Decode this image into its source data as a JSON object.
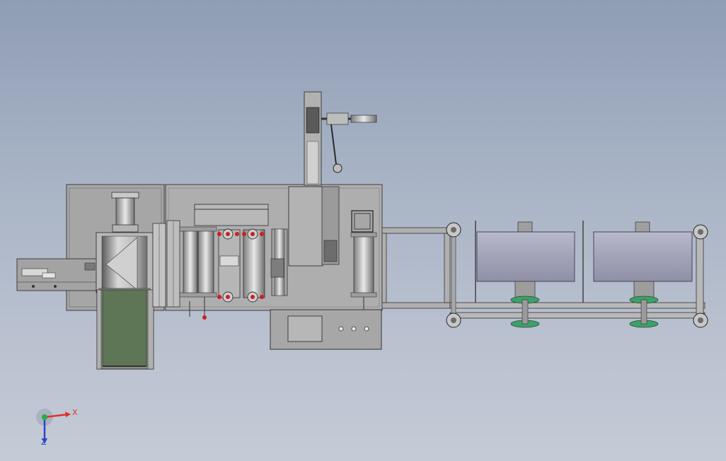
{
  "axis": {
    "x_label": "X",
    "z_label": "Z"
  },
  "colors": {
    "background_top": "#8f9db5",
    "background_bottom": "#c5cbd6",
    "machine_frame": "#a8a8a8",
    "machine_dark": "#5c5c5c",
    "roll_body": "#a9a9bd",
    "conveyor_belt": "#5e7556",
    "accent_red": "#cc1f1f",
    "gear_green": "#3f9f6a",
    "axis_x": "#e0312b",
    "axis_y": "#1fb04a",
    "axis_z": "#2b45c8"
  },
  "components": {
    "roll_count": 2,
    "red_roller_count": 4,
    "control_panel_buttons": 3
  }
}
